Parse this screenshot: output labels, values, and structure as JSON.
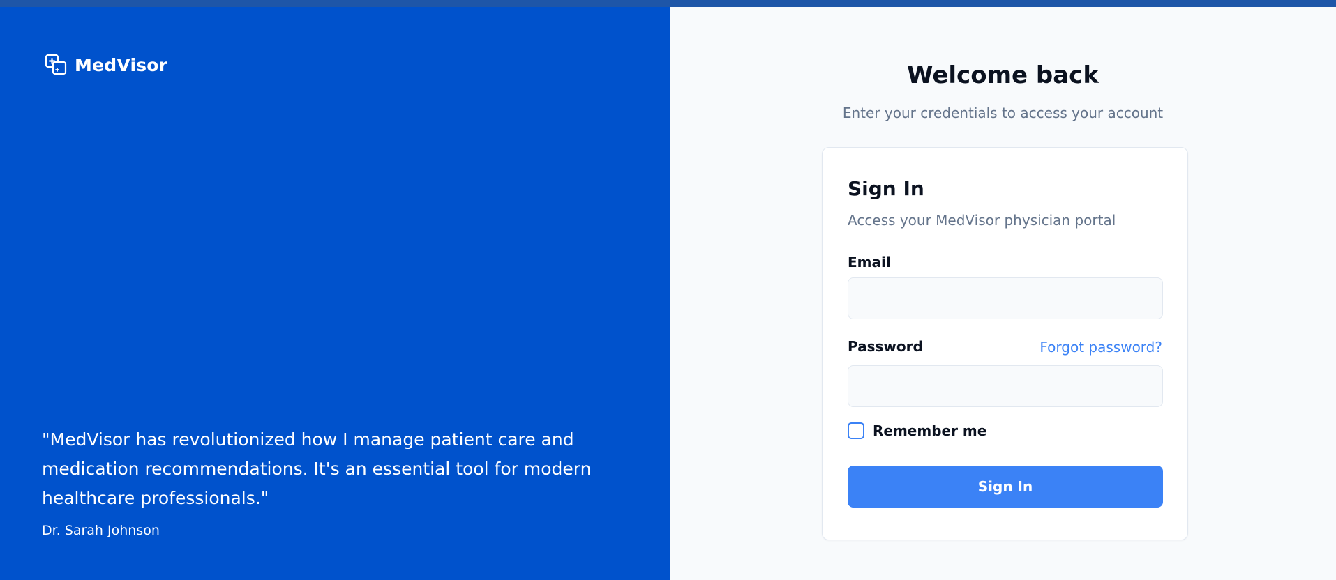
{
  "brand": {
    "name": "MedVisor",
    "icon": "medvisor-logo-icon"
  },
  "testimonial": {
    "quote": "\"MedVisor has revolutionized how I manage patient care and medication recommendations. It's an essential tool for modern healthcare professionals.\"",
    "author": "Dr. Sarah Johnson"
  },
  "welcome": {
    "title": "Welcome back",
    "subtitle": "Enter your credentials to access your account"
  },
  "signin_card": {
    "title": "Sign In",
    "subtitle": "Access your MedVisor physician portal",
    "email_label": "Email",
    "email_value": "",
    "email_placeholder": "",
    "password_label": "Password",
    "password_value": "",
    "password_placeholder": "",
    "forgot_password": "Forgot password?",
    "remember_me": "Remember me",
    "remember_checked": false,
    "submit_label": "Sign In"
  },
  "colors": {
    "brand_panel": "#0052cc",
    "accent": "#3b82f6",
    "topbar": "#1e56a8"
  }
}
